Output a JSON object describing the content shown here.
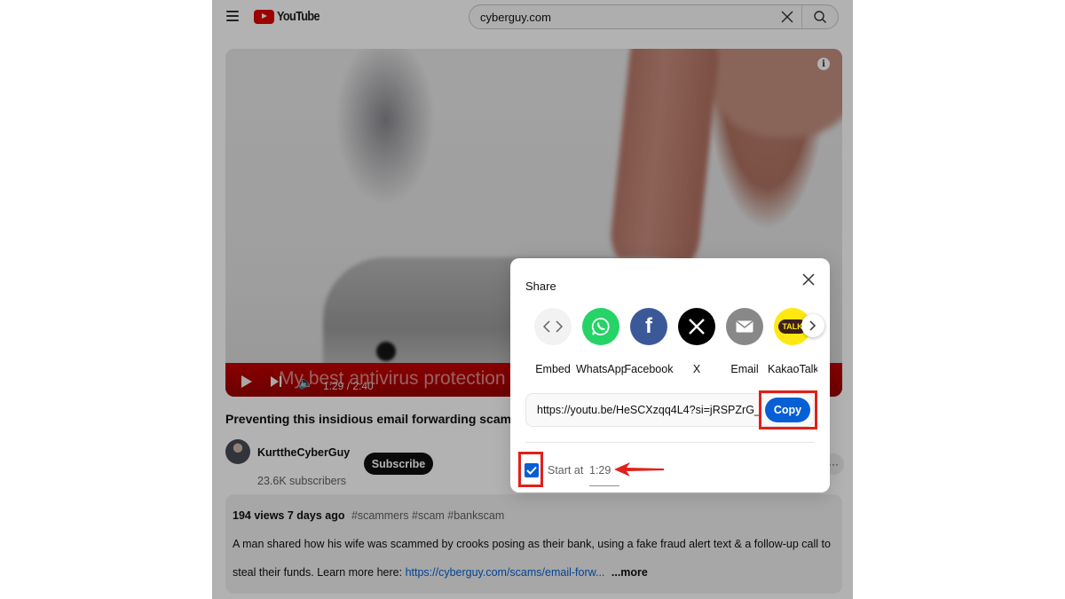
{
  "header": {
    "logo_text": "YouTube",
    "search_value": "cyberguy.com",
    "search_placeholder": "Search"
  },
  "player": {
    "overlay_title": "My best antivirus protection pi",
    "current_time": "1:29",
    "duration": "2:40",
    "time_display": "1:29 / 2:40"
  },
  "video": {
    "title": "Preventing this insidious email forwarding scam tha",
    "channel_name": "KurttheCyberGuy",
    "subscribers": "23.6K subscribers",
    "subscribe_label": "Subscribe"
  },
  "description": {
    "views": "194 views  7 days ago",
    "tags": "#scammers #scam #bankscam",
    "line1": "A man shared how his wife was scammed by crooks posing as their bank, using a fake fraud alert text & a follow-up call to",
    "line2_text": "steal their funds. Learn more here: ",
    "link": "https://cyberguy.com/scams/email-forw...",
    "more": "...more"
  },
  "share_dialog": {
    "title": "Share",
    "targets": [
      {
        "label": "Embed",
        "icon": "embed-icon",
        "color": "#f2f2f2"
      },
      {
        "label": "WhatsApp",
        "icon": "whatsapp-icon",
        "color": "#25d366"
      },
      {
        "label": "Facebook",
        "icon": "facebook-icon",
        "color": "#3b5998"
      },
      {
        "label": "X",
        "icon": "x-logo-icon",
        "color": "#000000"
      },
      {
        "label": "Email",
        "icon": "email-icon",
        "color": "#888888"
      },
      {
        "label": "KakaoTalk",
        "icon": "kakaotalk-icon",
        "color": "#ffe812"
      }
    ],
    "url": "https://youtu.be/HeSCXzqq4L4?si=jRSPZrG_",
    "copy_label": "Copy",
    "start_at_label": "Start at",
    "start_at_time": "1:29",
    "start_at_checked": true
  },
  "colors": {
    "youtube_red": "#e00000",
    "accent_blue": "#065fd4",
    "annotation_red": "#e0201a"
  }
}
